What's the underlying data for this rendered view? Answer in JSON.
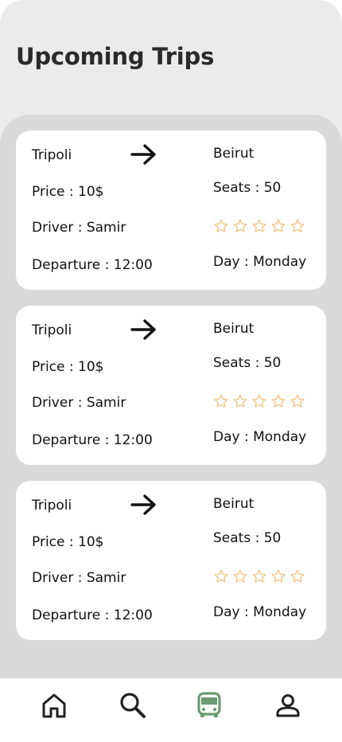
{
  "header": {
    "title": "Upcoming Trips"
  },
  "trips": [
    {
      "from": "Tripoli",
      "to": "Beirut",
      "price": "Price : 10$",
      "seats": "Seats : 50",
      "driver": "Driver : Samir",
      "departure": "Departure : 12:00",
      "day": "Day : Monday",
      "rating": 0
    },
    {
      "from": "Tripoli",
      "to": "Beirut",
      "price": "Price : 10$",
      "seats": "Seats : 50",
      "driver": "Driver : Samir",
      "departure": "Departure : 12:00",
      "day": "Day : Monday",
      "rating": 0
    },
    {
      "from": "Tripoli",
      "to": "Beirut",
      "price": "Price : 10$",
      "seats": "Seats : 50",
      "driver": "Driver : Samir",
      "departure": "Departure : 12:00",
      "day": "Day : Monday",
      "rating": 0
    }
  ],
  "nav": {
    "items": [
      {
        "icon": "home-icon",
        "active": false
      },
      {
        "icon": "search-icon",
        "active": false
      },
      {
        "icon": "bus-icon",
        "active": true
      },
      {
        "icon": "profile-icon",
        "active": false
      }
    ]
  },
  "colors": {
    "star": "#f3c98b",
    "active_nav": "#6b9a72",
    "inactive_nav": "#222222"
  }
}
